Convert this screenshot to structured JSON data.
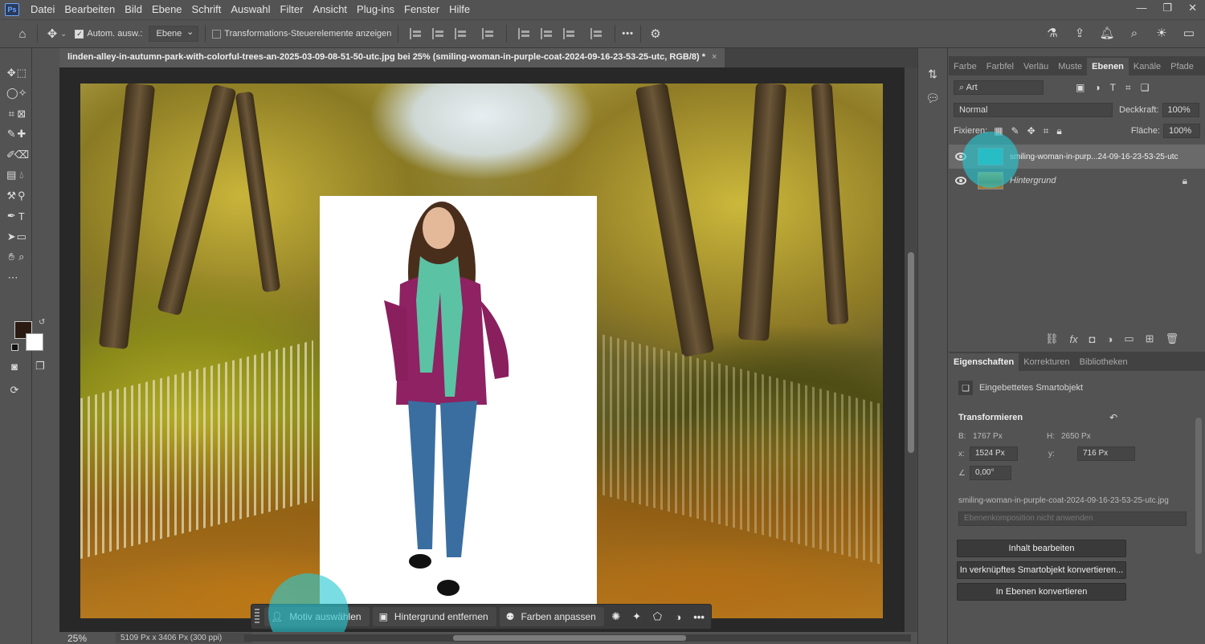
{
  "menubar": {
    "logo": "Ps",
    "items": [
      "Datei",
      "Bearbeiten",
      "Bild",
      "Ebene",
      "Schrift",
      "Auswahl",
      "Filter",
      "Ansicht",
      "Plug-ins",
      "Fenster",
      "Hilfe"
    ],
    "window_controls": [
      "—",
      "❐",
      "✕"
    ]
  },
  "options": {
    "auto_select_label": "Autom. ausw.:",
    "auto_select_target": "Ebene",
    "transform_controls_label": "Transformations-Steuerelemente anzeigen",
    "more": "•••"
  },
  "document": {
    "tab_title": "linden-alley-in-autumn-park-with-colorful-trees-an-2025-03-09-08-51-50-utc.jpg bei 25% (smiling-woman-in-purple-coat-2024-09-16-23-53-25-utc, RGB/8) *",
    "close": "×"
  },
  "taskbar": {
    "select_subject": "Motiv auswählen",
    "remove_background": "Hintergrund entfernen",
    "match_colors": "Farben anpassen",
    "more": "•••"
  },
  "status": {
    "zoom": "25%",
    "doc_info": "5109 Px x 3406 Px (300 ppi)",
    "arrow": "›"
  },
  "panels_top": {
    "tabs": [
      "Farbe",
      "Farbfel",
      "Verläu",
      "Muste",
      "Ebenen",
      "Kanäle",
      "Pfade"
    ],
    "active_tab": "Ebenen",
    "filter_kind": "Art",
    "blend_mode": "Normal",
    "opacity_label": "Deckkraft:",
    "opacity_value": "100%",
    "lock_label": "Fixieren:",
    "fill_label": "Fläche:",
    "fill_value": "100%",
    "layers": [
      {
        "name": "smiling-woman-in-purp...24-09-16-23-53-25-utc",
        "selected": true,
        "locked": false
      },
      {
        "name": "Hintergrund",
        "selected": false,
        "locked": true
      }
    ]
  },
  "panels_bottom": {
    "tabs": [
      "Eigenschaften",
      "Korrekturen",
      "Bibliotheken"
    ],
    "active_tab": "Eigenschaften",
    "object_type": "Eingebettetes Smartobjekt",
    "transform_header": "Transformieren",
    "w_label": "B:",
    "w_value": "1767 Px",
    "h_label": "H:",
    "h_value": "2650 Px",
    "x_label": "x:",
    "x_value": "1524 Px",
    "y_label": "y:",
    "y_value": "716 Px",
    "angle_value": "0,00°",
    "filename": "smiling-woman-in-purple-coat-2024-09-16-23-53-25-utc.jpg",
    "comp_placeholder": "Ebenenkomposition nicht anwenden",
    "btn_edit": "Inhalt bearbeiten",
    "btn_linked": "In verknüpftes Smartobjekt konvertieren...",
    "btn_layers": "In Ebenen konvertieren"
  },
  "colors": {
    "highlight": "#28c8d2",
    "foreground": "#2a1a12",
    "background": "#ffffff"
  }
}
